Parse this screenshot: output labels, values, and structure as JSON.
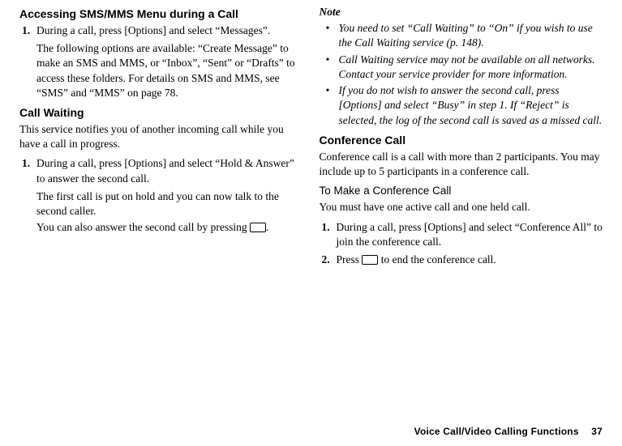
{
  "left": {
    "heading1": "Accessing SMS/MMS Menu during a Call",
    "step1": {
      "n": "1.",
      "text": "During a call, press [Options] and select “Messages”."
    },
    "p1": "The following options are available: “Create Message” to make an SMS and MMS, or “Inbox”, “Sent” or “Drafts” to access these folders. For details on SMS and MMS, see “SMS” and “MMS” on page 78.",
    "heading2": "Call Waiting",
    "p2": "This service notifies you of another incoming call while you have a call in progress.",
    "step2": {
      "n": "1.",
      "text": "During a call, press [Options] and select “Hold & Answer” to answer the second call."
    },
    "p3": "The first call is put on hold and you can now talk to the second caller.",
    "p4a": "You can also answer the second call by pressing ",
    "p4b": "."
  },
  "right": {
    "note_label": "Note",
    "bullets": [
      "You need to set “Call Waiting” to “On” if you wish to use the Call Waiting service (p. 148).",
      "Call Waiting service may not be available on all networks. Contact your service provider for more information.",
      "If you do not wish to answer the second call, press [Options] and select “Busy” in step 1. If “Reject” is selected, the log of the second call is saved as a missed call."
    ],
    "heading3": "Conference Call",
    "p5": "Conference call is a call with more than 2 participants. You may include up to 5 participants in a conference call.",
    "subheading": "To Make a Conference Call",
    "p6": "You must have one active call and one held call.",
    "step3": {
      "n": "1.",
      "text": "During a call, press [Options] and select “Conference All” to join the conference call."
    },
    "step4": {
      "n": "2.",
      "texta": "Press ",
      "textb": " to end the conference call."
    }
  },
  "footer": {
    "section": "Voice Call/Video Calling Functions",
    "page": "37"
  }
}
